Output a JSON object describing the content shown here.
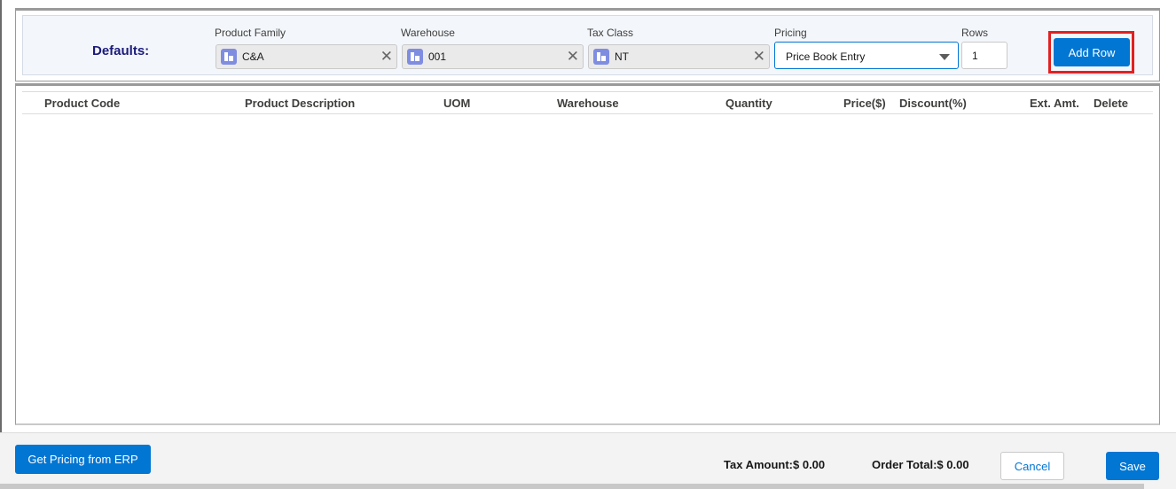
{
  "defaults": {
    "label": "Defaults:",
    "product_family": {
      "label": "Product Family",
      "value": "C&A",
      "clear": "✕"
    },
    "warehouse": {
      "label": "Warehouse",
      "value": "001",
      "clear": "✕"
    },
    "tax_class": {
      "label": "Tax Class",
      "value": "NT",
      "clear": "✕"
    },
    "pricing": {
      "label": "Pricing",
      "value": "Price Book Entry"
    },
    "rows": {
      "label": "Rows",
      "value": "1"
    },
    "add_row_label": "Add Row",
    "highlight_color": "#e02121"
  },
  "table": {
    "columns": [
      "Product Code",
      "Product Description",
      "UOM",
      "Warehouse",
      "Quantity",
      "Price($)",
      "Discount(%)",
      "Ext. Amt.",
      "Delete"
    ],
    "rows": []
  },
  "footer": {
    "erp_button_label": "Get Pricing from ERP",
    "tax_amount": "Tax Amount:$ 0.00",
    "order_total": "Order Total:$ 0.00",
    "cancel_label": "Cancel",
    "save_label": "Save"
  },
  "colors": {
    "accent": "#0176d3",
    "defaults_label": "#1b1b7a",
    "lookup_icon": "#7f8de1"
  },
  "icons": {
    "lookup": "record-lookup-icon",
    "clear": "close-icon",
    "dropdown": "chevron-down-icon"
  }
}
